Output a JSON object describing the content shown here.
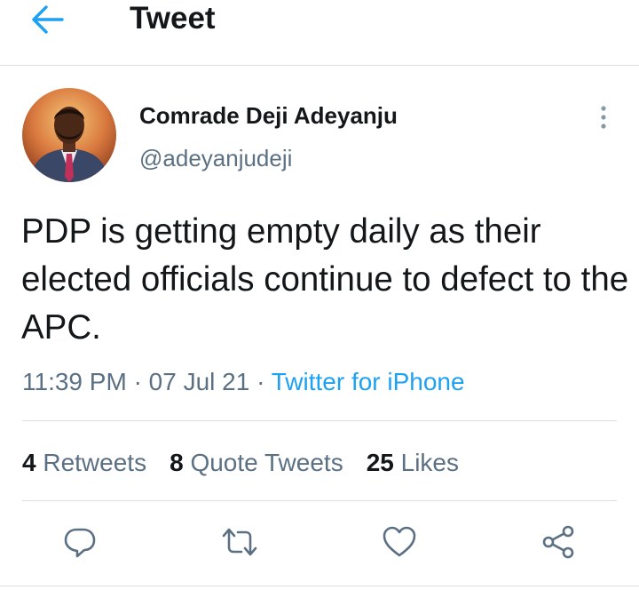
{
  "header": {
    "title": "Tweet",
    "back_icon": "arrow-left-icon",
    "accent_color": "#1da1f2"
  },
  "author": {
    "display_name": "Comrade Deji Adeyanju",
    "handle": "@adeyanjudeji",
    "more_icon": "more-vertical-icon"
  },
  "tweet": {
    "text": "PDP is getting empty daily as their elected officials continue to defect to the APC.",
    "time": "11:39 PM",
    "separator": "·",
    "date": "07 Jul 21",
    "source": "Twitter for iPhone"
  },
  "stats": {
    "retweets_count": "4",
    "retweets_label": "Retweets",
    "quotes_count": "8",
    "quotes_label": "Quote Tweets",
    "likes_count": "25",
    "likes_label": "Likes"
  },
  "actions": {
    "icons": [
      "reply-icon",
      "retweet-icon",
      "like-icon",
      "share-icon"
    ],
    "icon_color": "#5b7083"
  }
}
